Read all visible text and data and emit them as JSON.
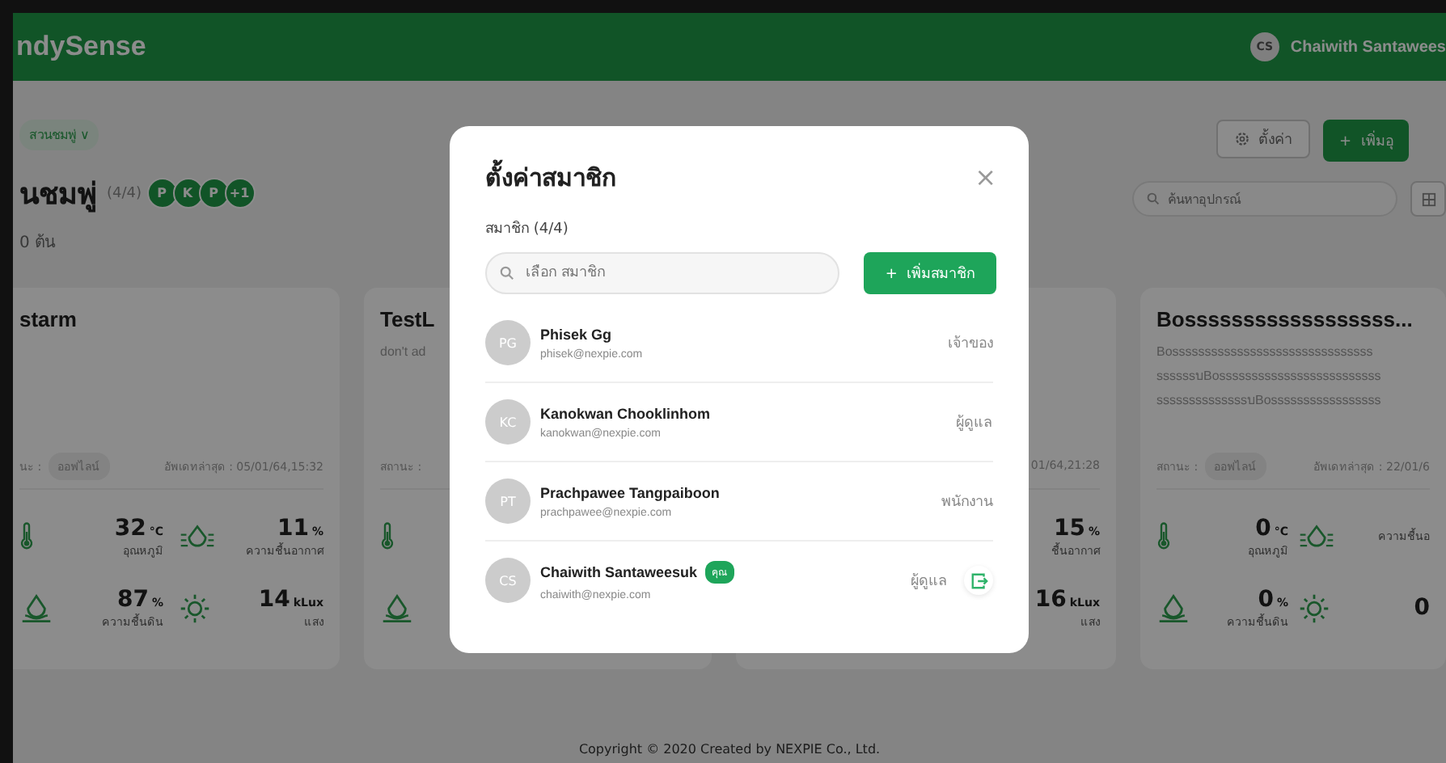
{
  "header": {
    "logo": "ndySense",
    "user": {
      "initials": "CS",
      "name": "Chaiwith Santawees"
    }
  },
  "breadcrumb": {
    "label": "สวนชมพู่",
    "caret": "∨"
  },
  "farm": {
    "title": "นชมพู่",
    "count": "(4/4)",
    "members": [
      "P",
      "K",
      "P",
      "+1"
    ],
    "subtitle": "0 ต้น"
  },
  "actions": {
    "settings": "ตั้งค่า",
    "add_plus": "+",
    "add": "เพิ่มอุ",
    "search_placeholder": "ค้นหาอุปกรณ์"
  },
  "cards": [
    {
      "title": "starm",
      "status_label": "นะ :",
      "status": "ออฟไลน์",
      "updated": "อัพเดทล่าสุด : 05/01/64,15:32",
      "metrics": [
        {
          "kind": "temperature",
          "show_icon": true,
          "value": "32",
          "unit": "°C",
          "label": "อุณหภูมิ"
        },
        {
          "kind": "air",
          "show_icon": true,
          "value": "11",
          "unit": "%",
          "label": "ความชื้นอากาศ"
        },
        {
          "kind": "soil",
          "show_icon": true,
          "value": "87",
          "unit": "%",
          "label": "ความชื้นดิน"
        },
        {
          "kind": "light",
          "show_icon": true,
          "value": "14",
          "unit": "kLux",
          "label": "แสง"
        }
      ]
    },
    {
      "title": "TestL",
      "description": [
        "don't ad"
      ],
      "status_label": "สถานะ :",
      "metrics": [
        {
          "kind": "temperature",
          "show_icon": true
        },
        {
          "kind": "soil",
          "show_icon": true
        }
      ]
    },
    {
      "updated": "01/64,21:28",
      "metrics": [
        {
          "kind": "air",
          "show_icon": false,
          "value": "15",
          "unit": "%",
          "label": "ชื้นอากาศ"
        },
        {
          "kind": "light",
          "show_icon": false,
          "value": "16",
          "unit": "kLux",
          "label": "แสง"
        }
      ]
    },
    {
      "title": "Bossssssssssssssssss...",
      "description": [
        "Bosssssssssssssssssssssssssssssss",
        "ssssssบBosssssssssssssssssssssssss",
        "ssssssssssssssบBosssssssssssssssss"
      ],
      "status_label": "สถานะ :",
      "status": "ออฟไลน์",
      "updated": "อัพเดทล่าสุด : 22/01/6",
      "metrics": [
        {
          "kind": "temperature",
          "show_icon": true,
          "value": "0",
          "unit": "°C",
          "label": "อุณหภูมิ"
        },
        {
          "kind": "air",
          "show_icon": true,
          "label": "ความชื้นอ"
        },
        {
          "kind": "soil",
          "show_icon": true,
          "value": "0",
          "unit": "%",
          "label": "ความชื้นดิน"
        },
        {
          "kind": "light",
          "show_icon": true,
          "value": "0"
        }
      ]
    }
  ],
  "footer": "Copyright © 2020 Created by NEXPIE Co., Ltd.",
  "modal": {
    "title": "ตั้งค่าสมาชิก",
    "close": "×",
    "count_label": "สมาชิก (4/4)",
    "search_placeholder": "เลือก สมาชิก",
    "add_plus": "+",
    "add_button": "เพิ่มสมาชิก",
    "members": [
      {
        "initials": "PG",
        "name": "Phisek Gg",
        "email": "phisek@nexpie.com",
        "role": "เจ้าของ",
        "can_leave": false
      },
      {
        "initials": "KC",
        "name": "Kanokwan Chooklinhom",
        "email": "kanokwan@nexpie.com",
        "role": "ผู้ดูแล",
        "can_leave": false
      },
      {
        "initials": "PT",
        "name": "Prachpawee Tangpaiboon",
        "email": "prachpawee@nexpie.com",
        "role": "พนักงาน",
        "can_leave": false
      },
      {
        "initials": "CS",
        "name": "Chaiwith Santaweesuk",
        "badge": "คุณ",
        "email": "chaiwith@nexpie.com",
        "role": "ผู้ดูแล",
        "can_leave": true
      }
    ]
  }
}
